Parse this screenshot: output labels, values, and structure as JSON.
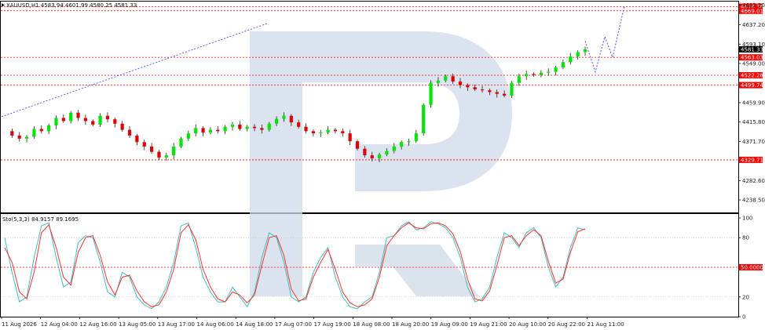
{
  "chart_data": [
    {
      "type": "candlestick",
      "title": "XAUUSD,H1  4583.94 4601.99 4580.25 4581.33",
      "symbol": "XAUUSD",
      "timeframe": "H1",
      "ohlc_last": {
        "open": 4583.94,
        "high": 4601.99,
        "low": 4580.25,
        "close": 4581.33
      },
      "ylim": [
        4210,
        4690
      ],
      "y_tick_labels": [
        "4682.20",
        "4637.20",
        "4593.10",
        "4549.00",
        "4459.90",
        "4415.80",
        "4371.70",
        "4282.60",
        "4238.50"
      ],
      "x_tick_labels": [
        "11 Aug 2026",
        "12 Aug 04:00",
        "12 Aug 16:00",
        "13 Aug 05:00",
        "13 Aug 17:00",
        "14 Aug 06:00",
        "14 Aug 18:00",
        "17 Aug 07:00",
        "17 Aug 19:00",
        "18 Aug 08:00",
        "18 Aug 20:00",
        "19 Aug 09:00",
        "19 Aug 21:00",
        "20 Aug 10:00",
        "20 Aug 22:00",
        "21 Aug 11:00"
      ],
      "levels": [
        {
          "value": 4678.36,
          "label": "4678.36",
          "color": "#ff0000"
        },
        {
          "value": 4669.01,
          "label": "4669.01",
          "color": "#ff0000"
        },
        {
          "value": 4563.03,
          "label": "4563.03",
          "color": "#ff0000"
        },
        {
          "value": 4522.28,
          "label": "4522.28",
          "color": "#ff0000"
        },
        {
          "value": 4499.74,
          "label": "4499.74",
          "color": "#ff0000"
        },
        {
          "value": 4329.71,
          "label": "4329.71",
          "color": "#ff0000"
        }
      ],
      "current_price": {
        "value": 4581.33,
        "label": "4581.33",
        "color": "#000000"
      },
      "close_path": [
        [
          0,
          4395
        ],
        [
          3,
          4385
        ],
        [
          6,
          4378
        ],
        [
          9,
          4382
        ],
        [
          12,
          4400
        ],
        [
          15,
          4395
        ],
        [
          18,
          4408
        ],
        [
          21,
          4425
        ],
        [
          24,
          4418
        ],
        [
          27,
          4437
        ],
        [
          30,
          4425
        ],
        [
          33,
          4418
        ],
        [
          36,
          4410
        ],
        [
          39,
          4430
        ],
        [
          42,
          4422
        ],
        [
          45,
          4412
        ],
        [
          48,
          4398
        ],
        [
          51,
          4385
        ],
        [
          54,
          4370
        ],
        [
          57,
          4360
        ],
        [
          60,
          4348
        ],
        [
          63,
          4335
        ],
        [
          66,
          4340
        ],
        [
          69,
          4360
        ],
        [
          72,
          4378
        ],
        [
          75,
          4390
        ],
        [
          78,
          4402
        ],
        [
          81,
          4392
        ],
        [
          84,
          4398
        ],
        [
          87,
          4395
        ],
        [
          90,
          4405
        ],
        [
          93,
          4410
        ],
        [
          96,
          4400
        ],
        [
          99,
          4405
        ],
        [
          102,
          4402
        ],
        [
          105,
          4398
        ],
        [
          108,
          4412
        ],
        [
          111,
          4423
        ],
        [
          114,
          4430
        ],
        [
          117,
          4415
        ],
        [
          120,
          4405
        ],
        [
          123,
          4395
        ],
        [
          126,
          4390
        ],
        [
          129,
          4392
        ],
        [
          132,
          4398
        ],
        [
          135,
          4395
        ],
        [
          138,
          4390
        ],
        [
          141,
          4372
        ],
        [
          144,
          4355
        ],
        [
          147,
          4340
        ],
        [
          150,
          4333
        ],
        [
          153,
          4342
        ],
        [
          156,
          4350
        ],
        [
          159,
          4360
        ],
        [
          162,
          4370
        ],
        [
          165,
          4372
        ],
        [
          168,
          4390
        ],
        [
          171,
          4455
        ],
        [
          174,
          4505
        ],
        [
          177,
          4510
        ],
        [
          180,
          4520
        ],
        [
          183,
          4508
        ],
        [
          186,
          4500
        ],
        [
          189,
          4495
        ],
        [
          192,
          4490
        ],
        [
          195,
          4488
        ],
        [
          198,
          4484
        ],
        [
          201,
          4480
        ],
        [
          204,
          4476
        ],
        [
          207,
          4505
        ],
        [
          210,
          4520
        ],
        [
          213,
          4525
        ],
        [
          216,
          4523
        ],
        [
          219,
          4528
        ],
        [
          222,
          4530
        ],
        [
          225,
          4540
        ],
        [
          228,
          4552
        ],
        [
          231,
          4565
        ],
        [
          234,
          4575
        ],
        [
          237,
          4581.33
        ]
      ],
      "colors": {
        "up": "#00e600",
        "down": "#e00000",
        "wick": "#222222"
      }
    },
    {
      "type": "line",
      "title": "Sto(5,3,3) 84.9157 89.1695",
      "indicator": "Stochastic",
      "parameters": [
        5,
        3,
        3
      ],
      "main_value": 84.9157,
      "signal_value": 89.1695,
      "ylim": [
        0,
        100
      ],
      "y_tick_labels": [
        "100",
        "80",
        "20",
        "0"
      ],
      "levels": [
        {
          "value": 50,
          "label": "50.0000",
          "color": "#ff0000"
        }
      ],
      "x": [
        0,
        3,
        6,
        9,
        12,
        15,
        18,
        21,
        24,
        27,
        30,
        33,
        36,
        39,
        42,
        45,
        48,
        51,
        54,
        57,
        60,
        63,
        66,
        69,
        72,
        75,
        78,
        81,
        84,
        87,
        90,
        93,
        96,
        99,
        102,
        105,
        108,
        111,
        114,
        117,
        120,
        123,
        126,
        129,
        132,
        135,
        138,
        141,
        144,
        147,
        150,
        153,
        156,
        159,
        162,
        165,
        168,
        171,
        174,
        177,
        180,
        183,
        186,
        189,
        192,
        195,
        198,
        201,
        204,
        207,
        210,
        213,
        216,
        219,
        222,
        225,
        228,
        231,
        234,
        237
      ],
      "series": [
        {
          "name": "",
          "color": "#3cbfbf",
          "values": [
            80,
            45,
            15,
            20,
            60,
            92,
            95,
            60,
            30,
            35,
            75,
            82,
            80,
            55,
            25,
            20,
            45,
            40,
            20,
            12,
            8,
            15,
            30,
            55,
            92,
            95,
            70,
            40,
            25,
            15,
            15,
            30,
            20,
            10,
            25,
            60,
            85,
            80,
            55,
            20,
            15,
            20,
            45,
            60,
            70,
            40,
            20,
            10,
            8,
            15,
            20,
            45,
            80,
            82,
            92,
            96,
            88,
            90,
            96,
            94,
            90,
            80,
            60,
            30,
            15,
            18,
            30,
            60,
            85,
            80,
            70,
            85,
            90,
            80,
            50,
            30,
            40,
            70,
            90,
            88
          ]
        },
        {
          "name": "",
          "color": "#ff3030",
          "values": [
            70,
            55,
            25,
            18,
            45,
            85,
            93,
            70,
            40,
            32,
            65,
            80,
            82,
            62,
            35,
            22,
            40,
            42,
            26,
            15,
            10,
            12,
            25,
            48,
            85,
            93,
            78,
            48,
            30,
            18,
            15,
            25,
            22,
            14,
            22,
            52,
            80,
            82,
            62,
            28,
            16,
            18,
            40,
            55,
            68,
            48,
            25,
            14,
            10,
            12,
            18,
            40,
            72,
            82,
            90,
            95,
            90,
            89,
            94,
            95,
            92,
            84,
            66,
            38,
            18,
            16,
            26,
            52,
            80,
            82,
            72,
            82,
            88,
            82,
            56,
            34,
            38,
            65,
            86,
            89
          ]
        }
      ]
    }
  ]
}
